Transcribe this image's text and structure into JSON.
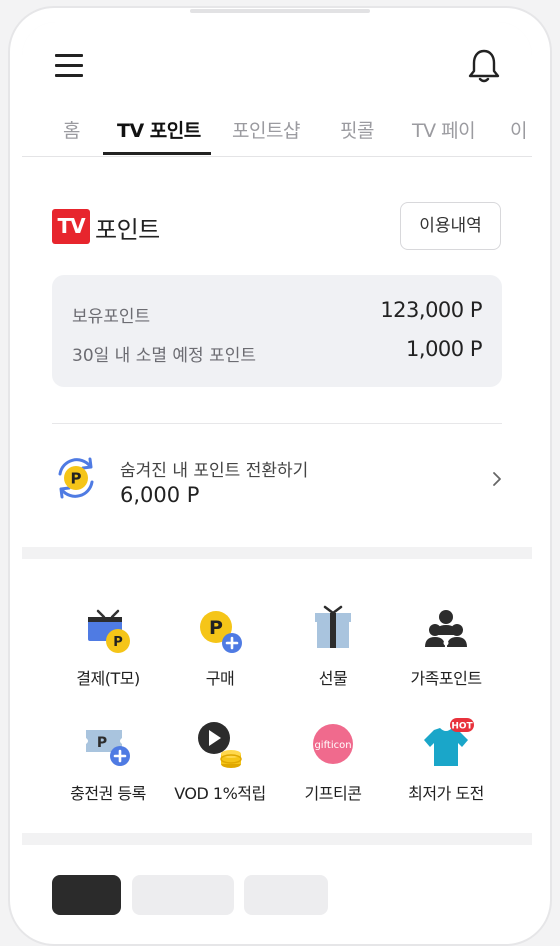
{
  "tabs": [
    {
      "label": "홈"
    },
    {
      "label": "TV 포인트"
    },
    {
      "label": "포인트샵"
    },
    {
      "label": "핏콜"
    },
    {
      "label": "TV 페이"
    },
    {
      "label": "이"
    }
  ],
  "active_tab_index": 1,
  "tv_point": {
    "logo_text": "TV",
    "title": "포인트",
    "history_button": "이용내역",
    "balance_label": "보유포인트",
    "balance_value": "123,000 P",
    "expiring_label": "30일 내 소멸 예정 포인트",
    "expiring_value": "1,000 P",
    "convert_label": "숨겨진 내 포인트 전환하기",
    "convert_value": "6,000 P",
    "convert_icon_letter": "P"
  },
  "services": [
    {
      "label": "결제(T모)",
      "icon": "tv-payment-icon"
    },
    {
      "label": "구매",
      "icon": "point-purchase-icon"
    },
    {
      "label": "선물",
      "icon": "gift-box-icon"
    },
    {
      "label": "가족포인트",
      "icon": "family-icon"
    },
    {
      "label": "충전권 등록",
      "icon": "voucher-add-icon"
    },
    {
      "label": "VOD 1%적립",
      "icon": "vod-coins-icon"
    },
    {
      "label": "기프티콘",
      "icon": "gifticon-icon",
      "icon_text": "gifticon"
    },
    {
      "label": "최저가 도전",
      "icon": "tshirt-hot-icon",
      "badge": "HOT"
    }
  ],
  "colors": {
    "brand_red": "#e7252d",
    "point_yellow": "#f5c518",
    "accent_blue": "#4f7be3",
    "hot_badge": "#e8323c",
    "gifticon_pink": "#f06a8d",
    "tshirt_teal": "#1aa6c9"
  }
}
